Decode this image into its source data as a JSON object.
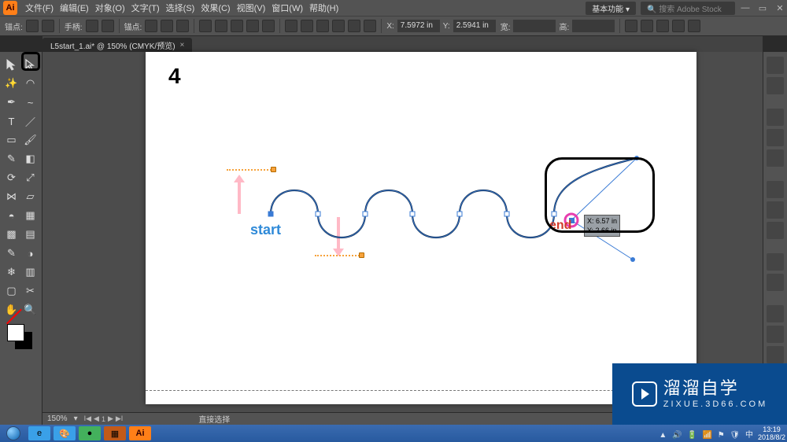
{
  "menu": {
    "items": [
      "文件(F)",
      "编辑(E)",
      "对象(O)",
      "文字(T)",
      "选择(S)",
      "效果(C)",
      "视图(V)",
      "窗口(W)",
      "帮助(H)"
    ],
    "workspace": "基本功能 ▾",
    "search_placeholder": "搜索 Adobe Stock"
  },
  "ctrl": {
    "anchor_label": "锚点:",
    "handle_label": "手柄:",
    "anchors_label": "锚点:",
    "x_label": "X:",
    "y_label": "Y:",
    "x_val": "7.5972 in",
    "y_val": "2.5941 in",
    "w_label": "宽:",
    "h_label": "高:"
  },
  "tab": {
    "title": "L5start_1.ai* @ 150% (CMYK/预览)",
    "close": "×"
  },
  "canvas": {
    "page_num": "4",
    "start_label": "start",
    "end_label": "end",
    "tooltip_x": "X: 6.57 in",
    "tooltip_y": "Y: 2.66 in"
  },
  "status": {
    "zoom": "150%",
    "tool": "直接选择"
  },
  "brand": {
    "cn": "溜溜自学",
    "url": "ZIXUE.3D66.COM"
  },
  "task": {
    "time": "13:19",
    "date": "2018/8/2"
  }
}
